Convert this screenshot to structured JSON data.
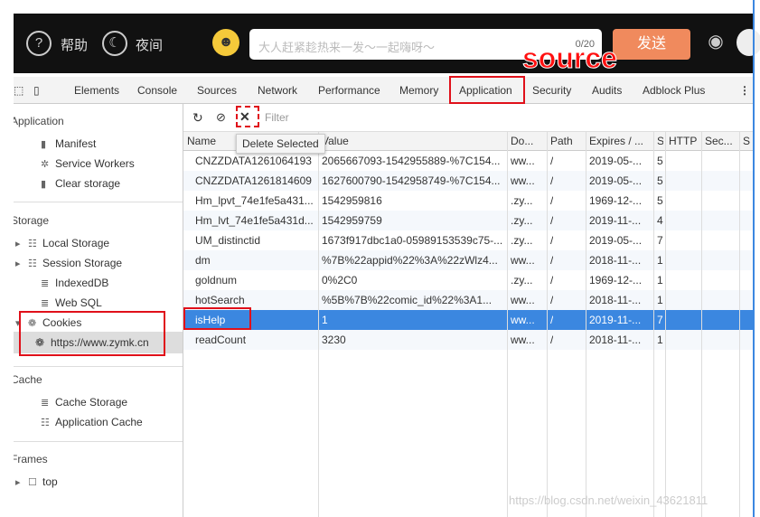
{
  "site": {
    "help": "帮助",
    "night": "夜间",
    "chat_placeholder": "大人赶紧趁热来一发～一起嗨呀～",
    "char_count": "0/20",
    "send": "发送"
  },
  "annotation": "source",
  "devtools": {
    "tabs": [
      "Elements",
      "Console",
      "Sources",
      "Network",
      "Performance",
      "Memory",
      "Application",
      "Security",
      "Audits",
      "Adblock Plus"
    ],
    "active_tab": "Application"
  },
  "sidebar": {
    "application": {
      "title": "Application",
      "items": [
        "Manifest",
        "Service Workers",
        "Clear storage"
      ]
    },
    "storage": {
      "title": "Storage",
      "items": [
        "Local Storage",
        "Session Storage",
        "IndexedDB",
        "Web SQL",
        "Cookies"
      ],
      "cookie_origin": "https://www.zymk.cn"
    },
    "cache": {
      "title": "Cache",
      "items": [
        "Cache Storage",
        "Application Cache"
      ]
    },
    "frames": {
      "title": "Frames",
      "items": [
        "top"
      ]
    }
  },
  "toolbar": {
    "filter_placeholder": "Filter",
    "tooltip": "Delete Selected"
  },
  "table": {
    "columns": [
      "Name",
      "Value",
      "Do...",
      "Path",
      "Expires / ...",
      "S",
      "HTTP",
      "Sec...",
      "S"
    ],
    "rows": [
      [
        "CNZZDATA1261064193",
        "2065667093-1542955889-%7C154...",
        "ww...",
        "/",
        "2019-05-...",
        "5"
      ],
      [
        "CNZZDATA1261814609",
        "1627600790-1542958749-%7C154...",
        "ww...",
        "/",
        "2019-05-...",
        "5"
      ],
      [
        "Hm_lpvt_74e1fe5a431...",
        "1542959816",
        ".zy...",
        "/",
        "1969-12-...",
        "5"
      ],
      [
        "Hm_lvt_74e1fe5a431d...",
        "1542959759",
        ".zy...",
        "/",
        "2019-11-...",
        "4"
      ],
      [
        "UM_distinctid",
        "1673f917dbc1a0-05989153539c75-...",
        ".zy...",
        "/",
        "2019-05-...",
        "7"
      ],
      [
        "dm",
        "%7B%22appid%22%3A%22zWlz4...",
        "ww...",
        "/",
        "2018-11-...",
        "1"
      ],
      [
        "goldnum",
        "0%2C0",
        ".zy...",
        "/",
        "1969-12-...",
        "1"
      ],
      [
        "hotSearch",
        "%5B%7B%22comic_id%22%3A1...",
        "ww...",
        "/",
        "2018-11-...",
        "1"
      ],
      [
        "isHelp",
        "1",
        "ww...",
        "/",
        "2019-11-...",
        "7"
      ],
      [
        "readCount",
        "3230",
        "ww...",
        "/",
        "2018-11-...",
        "1"
      ]
    ],
    "selected_row": "isHelp"
  },
  "watermark": "https://blog.csdn.net/weixin_43621811"
}
